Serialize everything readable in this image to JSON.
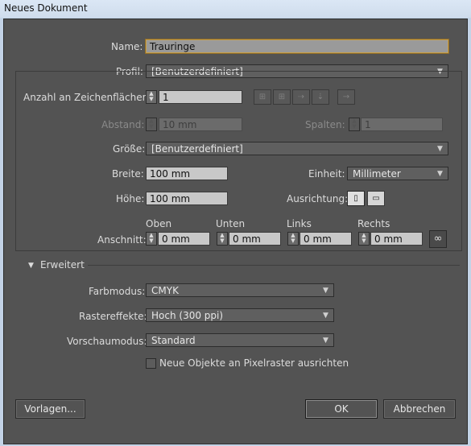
{
  "window": {
    "title": "Neues Dokument"
  },
  "name": {
    "label": "Name:",
    "value": "Trauringe"
  },
  "profil": {
    "label": "Profil:",
    "value": "[Benutzerdefiniert]"
  },
  "artboards": {
    "label": "Anzahl an Zeichenflächen:",
    "value": "1"
  },
  "abstand": {
    "label": "Abstand:",
    "value": "10 mm"
  },
  "spalten": {
    "label": "Spalten:",
    "value": "1"
  },
  "groesse": {
    "label": "Größe:",
    "value": "[Benutzerdefiniert]"
  },
  "breite": {
    "label": "Breite:",
    "value": "100 mm"
  },
  "einheit": {
    "label": "Einheit:",
    "value": "Millimeter"
  },
  "hoehe": {
    "label": "Höhe:",
    "value": "100 mm"
  },
  "ausrichtung": {
    "label": "Ausrichtung:"
  },
  "anschnitt": {
    "label": "Anschnitt:",
    "oben": {
      "label": "Oben",
      "value": "0 mm"
    },
    "unten": {
      "label": "Unten",
      "value": "0 mm"
    },
    "links": {
      "label": "Links",
      "value": "0 mm"
    },
    "rechts": {
      "label": "Rechts",
      "value": "0 mm"
    }
  },
  "erweitert": {
    "label": "Erweitert"
  },
  "farbmodus": {
    "label": "Farbmodus:",
    "value": "CMYK"
  },
  "rastereffekte": {
    "label": "Rastereffekte:",
    "value": "Hoch (300 ppi)"
  },
  "vorschaumodus": {
    "label": "Vorschaumodus:",
    "value": "Standard"
  },
  "pixelraster": {
    "label": "Neue Objekte an Pixelraster ausrichten",
    "checked": false
  },
  "buttons": {
    "vorlagen": "Vorlagen...",
    "ok": "OK",
    "abbrechen": "Abbrechen"
  },
  "icons": {
    "arrange": [
      "grid-by-row-icon",
      "grid-by-column-icon",
      "arrange-by-row-icon",
      "arrange-by-column-icon",
      "right-to-left-icon"
    ],
    "orientation": [
      "portrait-icon",
      "landscape-icon"
    ],
    "link": "chain-link-icon",
    "dropdown": "chevron-down-icon",
    "disclosure": "triangle-down-icon"
  }
}
